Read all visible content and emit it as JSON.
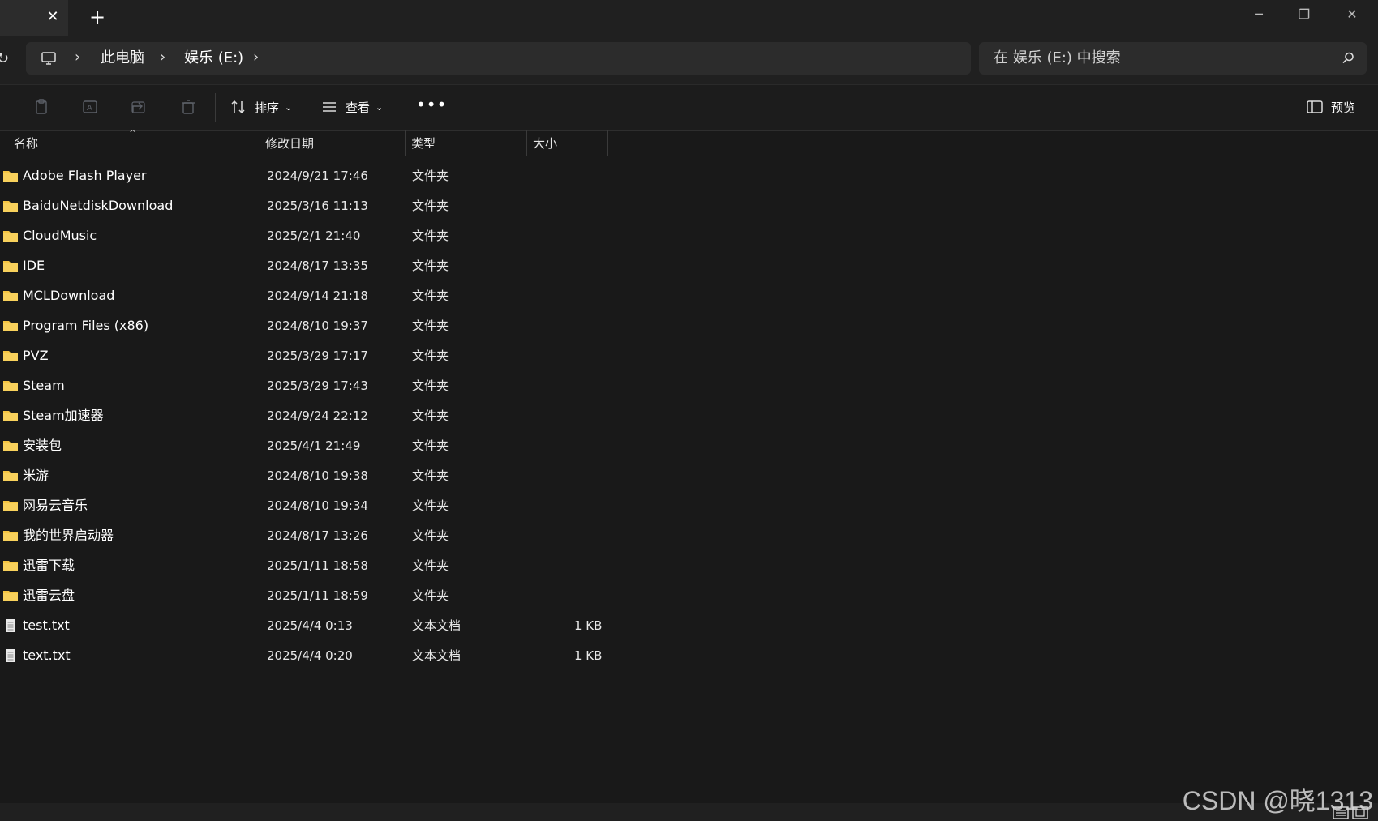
{
  "tab": {
    "close_label": "✕",
    "new_label": "+"
  },
  "window": {
    "minimize": "─",
    "restore": "❐",
    "close": "✕"
  },
  "address": {
    "crumbs": [
      "此电脑",
      "娱乐 (E:)"
    ]
  },
  "search": {
    "placeholder": "在 娱乐 (E:) 中搜索"
  },
  "toolbar": {
    "sort_label": "排序",
    "view_label": "查看",
    "more_label": "•••",
    "preview_label": "预览"
  },
  "columns": {
    "name": "名称",
    "modified": "修改日期",
    "type": "类型",
    "size": "大小"
  },
  "files": [
    {
      "name": "Adobe Flash Player",
      "modified": "2024/9/21 17:46",
      "type": "文件夹",
      "size": "",
      "icon": "folder-icon"
    },
    {
      "name": "BaiduNetdiskDownload",
      "modified": "2025/3/16 11:13",
      "type": "文件夹",
      "size": "",
      "icon": "folder-icon"
    },
    {
      "name": "CloudMusic",
      "modified": "2025/2/1 21:40",
      "type": "文件夹",
      "size": "",
      "icon": "folder-icon"
    },
    {
      "name": "IDE",
      "modified": "2024/8/17 13:35",
      "type": "文件夹",
      "size": "",
      "icon": "folder-icon"
    },
    {
      "name": "MCLDownload",
      "modified": "2024/9/14 21:18",
      "type": "文件夹",
      "size": "",
      "icon": "folder-icon"
    },
    {
      "name": "Program Files (x86)",
      "modified": "2024/8/10 19:37",
      "type": "文件夹",
      "size": "",
      "icon": "folder-icon"
    },
    {
      "name": "PVZ",
      "modified": "2025/3/29 17:17",
      "type": "文件夹",
      "size": "",
      "icon": "folder-icon"
    },
    {
      "name": "Steam",
      "modified": "2025/3/29 17:43",
      "type": "文件夹",
      "size": "",
      "icon": "folder-icon"
    },
    {
      "name": "Steam加速器",
      "modified": "2024/9/24 22:12",
      "type": "文件夹",
      "size": "",
      "icon": "folder-icon"
    },
    {
      "name": "安装包",
      "modified": "2025/4/1 21:49",
      "type": "文件夹",
      "size": "",
      "icon": "folder-icon"
    },
    {
      "name": "米游",
      "modified": "2024/8/10 19:38",
      "type": "文件夹",
      "size": "",
      "icon": "folder-icon"
    },
    {
      "name": "网易云音乐",
      "modified": "2024/8/10 19:34",
      "type": "文件夹",
      "size": "",
      "icon": "folder-icon"
    },
    {
      "name": "我的世界启动器",
      "modified": "2024/8/17 13:26",
      "type": "文件夹",
      "size": "",
      "icon": "folder-icon"
    },
    {
      "name": "迅雷下载",
      "modified": "2025/1/11 18:58",
      "type": "文件夹",
      "size": "",
      "icon": "folder-icon"
    },
    {
      "name": "迅雷云盘",
      "modified": "2025/1/11 18:59",
      "type": "文件夹",
      "size": "",
      "icon": "folder-icon"
    },
    {
      "name": "test.txt",
      "modified": "2025/4/4 0:13",
      "type": "文本文档",
      "size": "1 KB",
      "icon": "text-file-icon"
    },
    {
      "name": "text.txt",
      "modified": "2025/4/4 0:20",
      "type": "文本文档",
      "size": "1 KB",
      "icon": "text-file-icon"
    }
  ],
  "watermark": "CSDN @晓1313",
  "colors": {
    "background": "#191919",
    "folder": "#f5c542",
    "bar": "#202020",
    "field": "#2c2c2c"
  }
}
